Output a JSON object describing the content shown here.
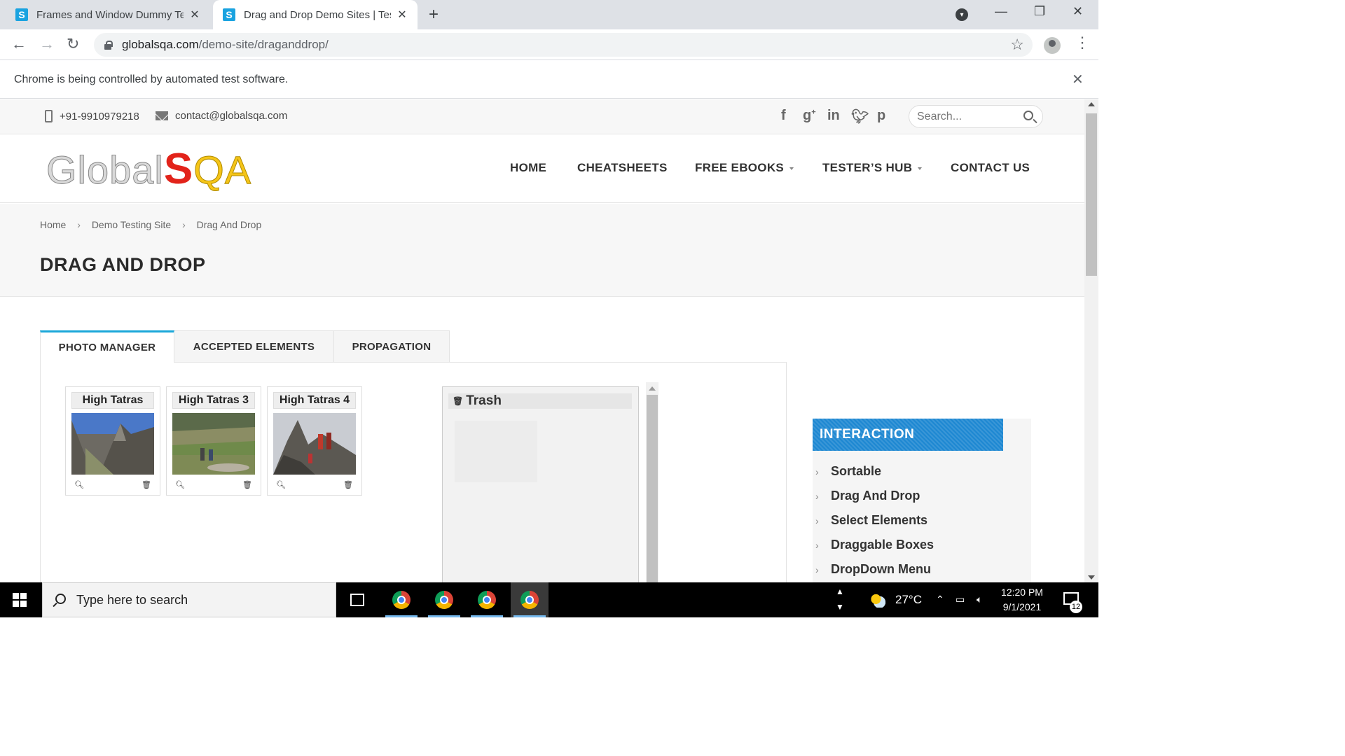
{
  "browser": {
    "tabs": [
      {
        "favicon": "S",
        "title": "Frames and Window Dummy Testing Site",
        "active": false
      },
      {
        "favicon": "S",
        "title": "Drag and Drop Demo Sites | Testing",
        "active": true
      }
    ],
    "url_host": "globalsqa.com",
    "url_path": "/demo-site/draganddrop/",
    "infobar": "Chrome is being controlled by automated test software."
  },
  "topbar": {
    "phone": "+91-9910979218",
    "email": "contact@globalsqa.com",
    "social": [
      "facebook-icon",
      "google-plus-icon",
      "linkedin-icon",
      "twitter-icon",
      "pinterest-icon"
    ],
    "search_placeholder": "Search..."
  },
  "logo": {
    "part1": "Global",
    "part2": "S",
    "part3": "QA"
  },
  "nav": {
    "home": "HOME",
    "cheatsheets": "CHEATSHEETS",
    "free_ebooks": "FREE EBOOKS",
    "testers_hub": "TESTER’S HUB",
    "contact_us": "CONTACT US"
  },
  "breadcrumb": {
    "home": "Home",
    "demo": "Demo Testing Site",
    "current": "Drag And Drop",
    "sep": "›"
  },
  "page_title": "DRAG AND DROP",
  "tabs": {
    "photo_manager": "PHOTO MANAGER",
    "accepted_elements": "ACCEPTED ELEMENTS",
    "propagation": "PROPAGATION"
  },
  "gallery": [
    {
      "title": "High Tatras"
    },
    {
      "title": "High Tatras 3"
    },
    {
      "title": "High Tatras 4"
    }
  ],
  "trash": {
    "title": "Trash"
  },
  "sidebar": {
    "title": "INTERACTION",
    "items": [
      "Sortable",
      "Drag And Drop",
      "Select Elements",
      "Draggable Boxes",
      "DropDown Menu"
    ]
  },
  "taskbar": {
    "search_placeholder": "Type here to search",
    "temperature": "27°C",
    "time": "12:20 PM",
    "date": "9/1/2021",
    "notifications": "12"
  },
  "colors": {
    "accent": "#1ba7d9",
    "widget": "#1e88d2",
    "logo_red": "#e2231a",
    "logo_yellow": "#f5c518"
  }
}
